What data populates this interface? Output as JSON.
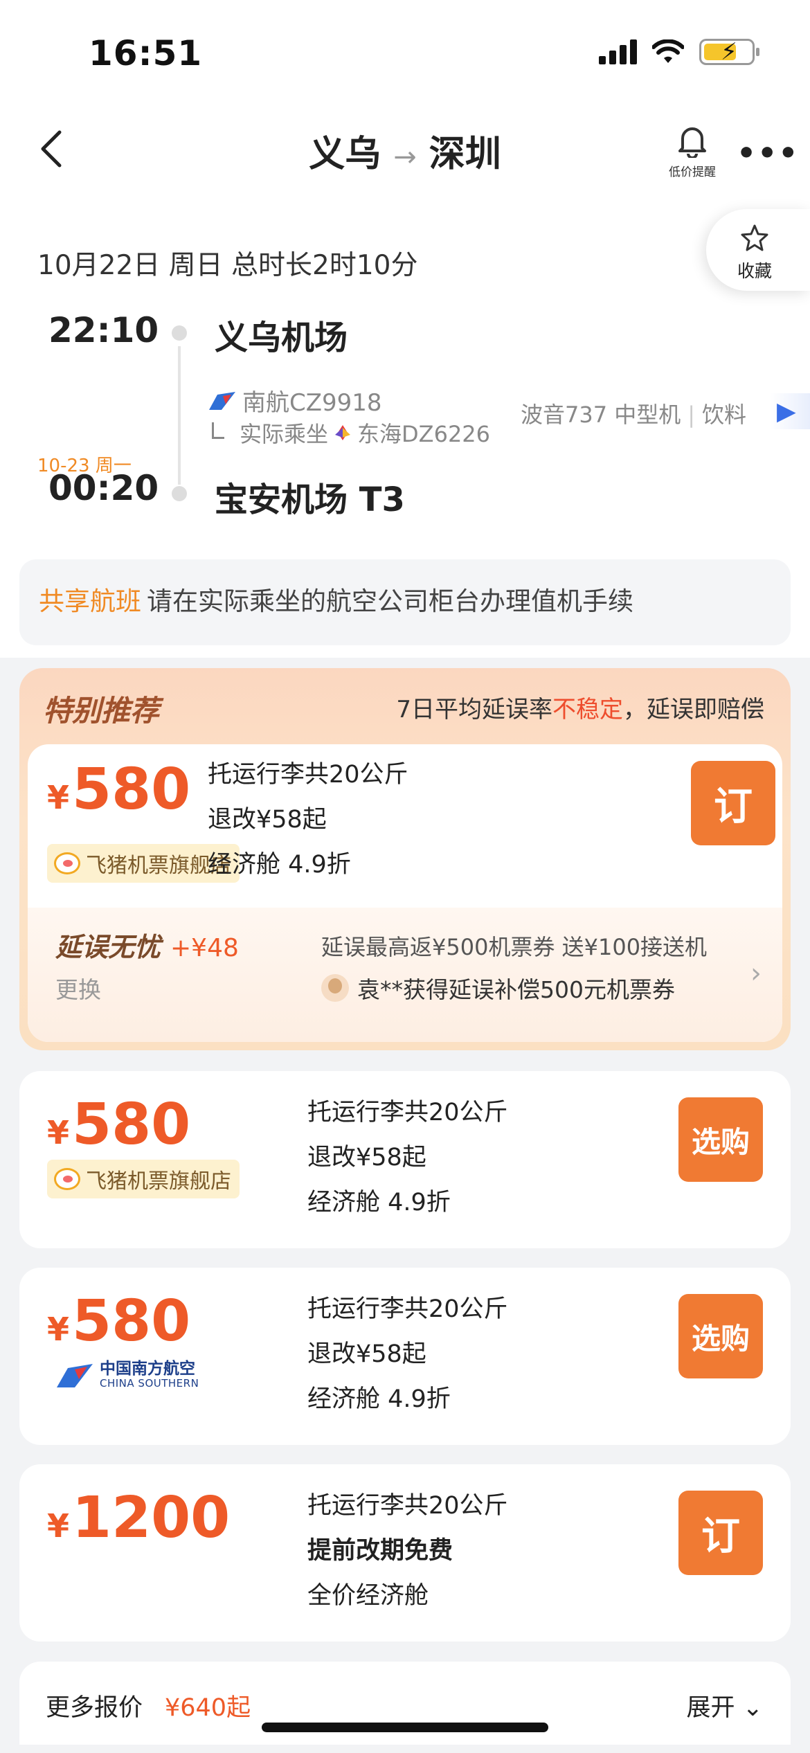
{
  "status_bar": {
    "time": "16:51"
  },
  "header": {
    "from": "义乌",
    "arrow": "→",
    "to": "深圳",
    "price_alert_label": "低价提醒",
    "more_label": "•••",
    "favorite_label": "收藏"
  },
  "flight": {
    "date_line": "10月22日  周日  总时长2时10分",
    "departure_time": "22:10",
    "departure_airport": "义乌机场",
    "airline_flight": "南航CZ9918",
    "actual_prefix": "实际乘坐",
    "actual_flight": "东海DZ6226",
    "aircraft": "波音737 中型机",
    "meal": "饮料",
    "arrival_date_note": "10-23 周一",
    "arrival_time": "00:20",
    "arrival_airport": "宝安机场 T3"
  },
  "share_notice": {
    "tag": "共享航班",
    "text": "请在实际乘坐的航空公司柜台办理值机手续"
  },
  "special": {
    "title": "特别推荐",
    "note_prefix": "7日平均延误率",
    "note_warn": "不稳定",
    "note_suffix": "，延误即赔偿",
    "offer": {
      "currency": "¥",
      "price": "580",
      "store": "飞猪机票旗舰店",
      "line1": "托运行李共20公斤",
      "line2": "退改¥58起",
      "line3": "经济舱 4.9折",
      "button": "订"
    },
    "delay": {
      "title": "延误无忧",
      "plus": "+¥48",
      "change": "更换",
      "benefit": "延误最高返¥500机票券   送¥100接送机",
      "user_text": "袁**获得延误补偿500元机票券",
      "chevron": "›"
    }
  },
  "offers": [
    {
      "currency": "¥",
      "price": "580",
      "store": "飞猪机票旗舰店",
      "line1": "托运行李共20公斤",
      "line2": "退改¥58起",
      "line3": "经济舱 4.9折",
      "button": "选购"
    },
    {
      "currency": "¥",
      "price": "580",
      "airline_cn": "中国南方航空",
      "airline_en": "CHINA SOUTHERN",
      "line1": "托运行李共20公斤",
      "line2": "退改¥58起",
      "line3": "经济舱 4.9折",
      "button": "选购"
    },
    {
      "currency": "¥",
      "price": "1200",
      "line1": "托运行李共20公斤",
      "line2": "提前改期免费",
      "line3": "全价经济舱",
      "button": "订"
    }
  ],
  "more_prices": {
    "label": "更多报价",
    "value": "¥640起",
    "expand": "展开 ⌄"
  },
  "colors": {
    "accent_orange": "#f07a33",
    "price_red": "#ee5a28",
    "warn_red": "#ee4d2d",
    "notice_orange": "#f08a24"
  }
}
